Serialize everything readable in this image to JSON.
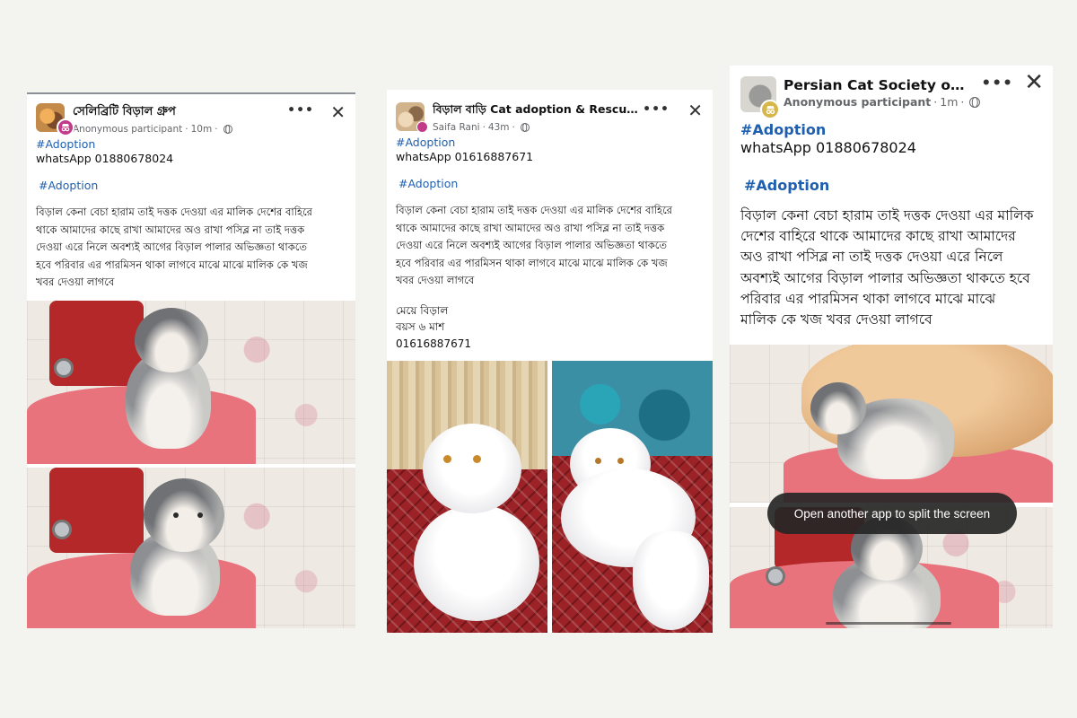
{
  "posts": [
    {
      "group_name": "সেলিব্রিটি বিড়াল গ্রুপ",
      "author": "Anonymous participant",
      "time": "10m",
      "lines": [
        "#Adoption",
        "whatsApp 01880678024",
        "#Adoption"
      ],
      "paragraph": [
        "বিড়াল কেনা বেচা হারাম তাই দত্তক দেওয়া এর মালিক দেশের বাহিরে",
        "থাকে আমাদের কাছে রাখা আমাদের অও রাখা পসিব্ল না তাই দত্তক",
        "দেওয়া এরে নিলে অবশ্যই আগের বিড়াল পালার অভিজ্ঞতা থাকতে",
        "হবে পরিবার এর পারমিসন থাকা লাগবে মাঝে মাঝে মালিক কে খজ",
        "খবর দেওয়া লাগবে"
      ],
      "photos": [
        "kitten-on-pink-chair",
        "kitten-on-pink-chair"
      ]
    },
    {
      "group_name": "বিড়াল বাড়ি Cat adoption & Rescue Soc...",
      "author": "Saifa Rani",
      "time": "43m",
      "lines": [
        "#Adoption",
        "whatsApp 01616887671",
        "#Adoption"
      ],
      "paragraph": [
        "বিড়াল কেনা বেচা হারাম তাই দত্তক দেওয়া এর মালিক দেশের বাহিরে",
        "থাকে আমাদের কাছে রাখা আমাদের অও রাখা পসিব্ল না তাই দত্তক",
        "দেওয়া এরে নিলে অবশ্যই আগের বিড়াল পালার অভিজ্ঞতা থাকতে",
        "হবে পরিবার এর পারমিসন থাকা লাগবে মাঝে মাঝে মালিক কে খজ",
        "খবর দেওয়া লাগবে"
      ],
      "info": [
        "মেয়ে বিড়াল",
        "বয়স ৬ মাশ",
        "01616887671"
      ],
      "photos": [
        "white-cat-on-rug",
        "white-cat-lying-on-rug"
      ]
    },
    {
      "group_name": "Persian Cat Society of Dh...",
      "author": "Anonymous participant",
      "time": "1m",
      "lines": [
        "#Adoption",
        "whatsApp 01880678024",
        "#Adoption"
      ],
      "paragraph": [
        "বিড়াল কেনা বেচা হারাম তাই দত্তক দেওয়া এর মালিক",
        "দেশের বাহিরে থাকে আমাদের কাছে রাখা আমাদের",
        "অও রাখা পসিব্ল না তাই দত্তক দেওয়া এরে নিলে",
        "অবশ্যই আগের বিড়াল পালার অভিজ্ঞতা থাকতে হবে",
        "পরিবার এর পারমিসন থাকা লাগবে মাঝে মাঝে",
        "মালিক কে খজ খবর দেওয়া লাগবে"
      ],
      "photos": [
        "kitten-with-orange-cat",
        "kitten-on-pink-chair"
      ],
      "toast": "Open another app to split the screen"
    }
  ],
  "icons": {
    "more": "•••",
    "close": "✕",
    "privacy": "globe-icon",
    "dot": "·"
  },
  "colors": {
    "hashtag": "#1e5fb0",
    "anon_badge_1": "#c23b8a",
    "anon_badge_3": "#d7b74a"
  }
}
